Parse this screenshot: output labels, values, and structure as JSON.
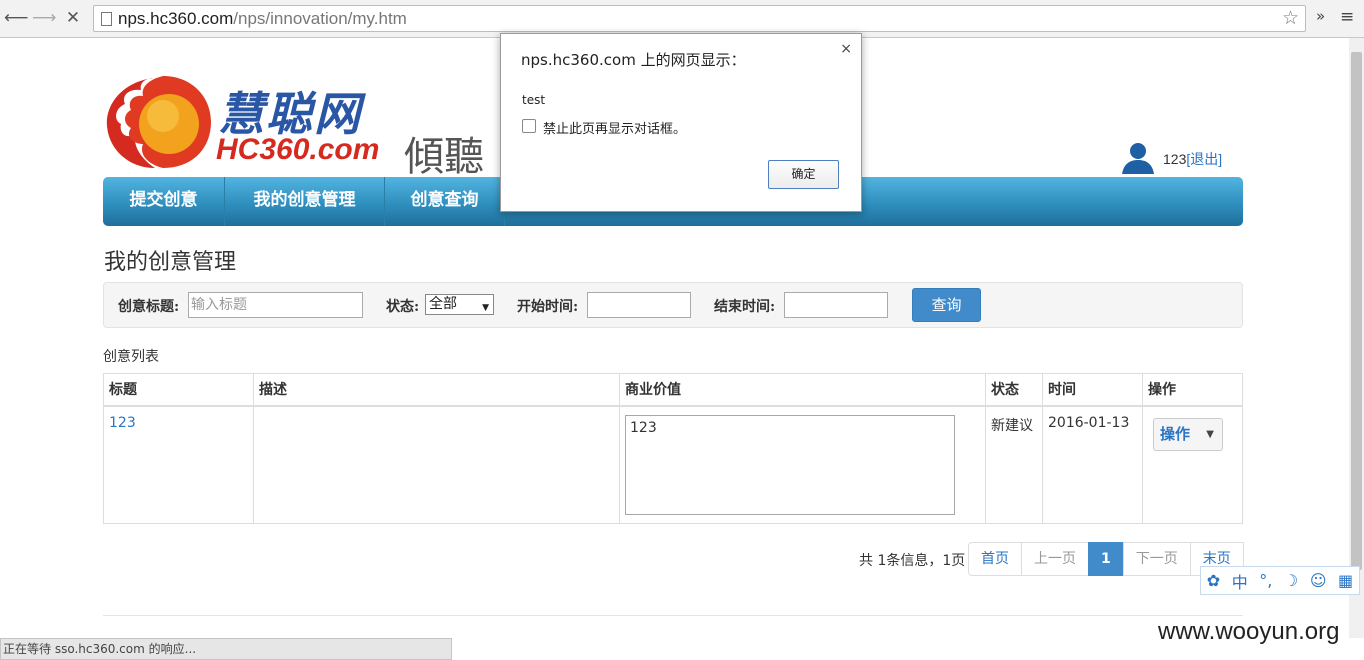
{
  "browser": {
    "url_host": "nps.hc360.com",
    "url_path": "/nps/innovation/my.htm",
    "status_text": "正在等待 sso.hc360.com 的响应..."
  },
  "logo": {
    "cn": "慧聪网",
    "en": "HC360.com",
    "slogan": "傾聽"
  },
  "user": {
    "name": "123",
    "logout": "[退出]"
  },
  "menu": {
    "items": [
      {
        "label": "提交创意"
      },
      {
        "label": "我的创意管理"
      },
      {
        "label": "创意查询"
      }
    ]
  },
  "page": {
    "title": "我的创意管理",
    "list_caption": "创意列表"
  },
  "search": {
    "title_label": "创意标题:",
    "title_placeholder": "输入标题",
    "status_label": "状态:",
    "status_value": "全部",
    "start_label": "开始时间:",
    "start_value": "",
    "end_label": "结束时间:",
    "end_value": "",
    "query_button": "查询"
  },
  "table": {
    "headers": [
      "标题",
      "描述",
      "商业价值",
      "状态",
      "时间",
      "操作"
    ],
    "rows": [
      {
        "title": "123",
        "desc": "",
        "value": "123",
        "status": "新建议",
        "time": "2016-01-13",
        "action": "操作"
      }
    ]
  },
  "pager": {
    "info": "共 1条信息，1页",
    "first": "首页",
    "prev": "上一页",
    "current": "1",
    "next": "下一页",
    "last": "末页"
  },
  "ime": [
    "中",
    "°,",
    "☽",
    "☺",
    "▦"
  ],
  "dialog": {
    "title": "nps.hc360.com 上的网页显示：",
    "message": "test",
    "checkbox_label": "禁止此页再显示对话框。",
    "ok": "确定",
    "close": "×"
  },
  "watermark": "www.wooyun.org",
  "colors": {
    "menu_blue": "#2f8fbe",
    "link_blue": "#2a74c4",
    "button_blue": "#428bca",
    "logo_red": "#d42a1f"
  }
}
